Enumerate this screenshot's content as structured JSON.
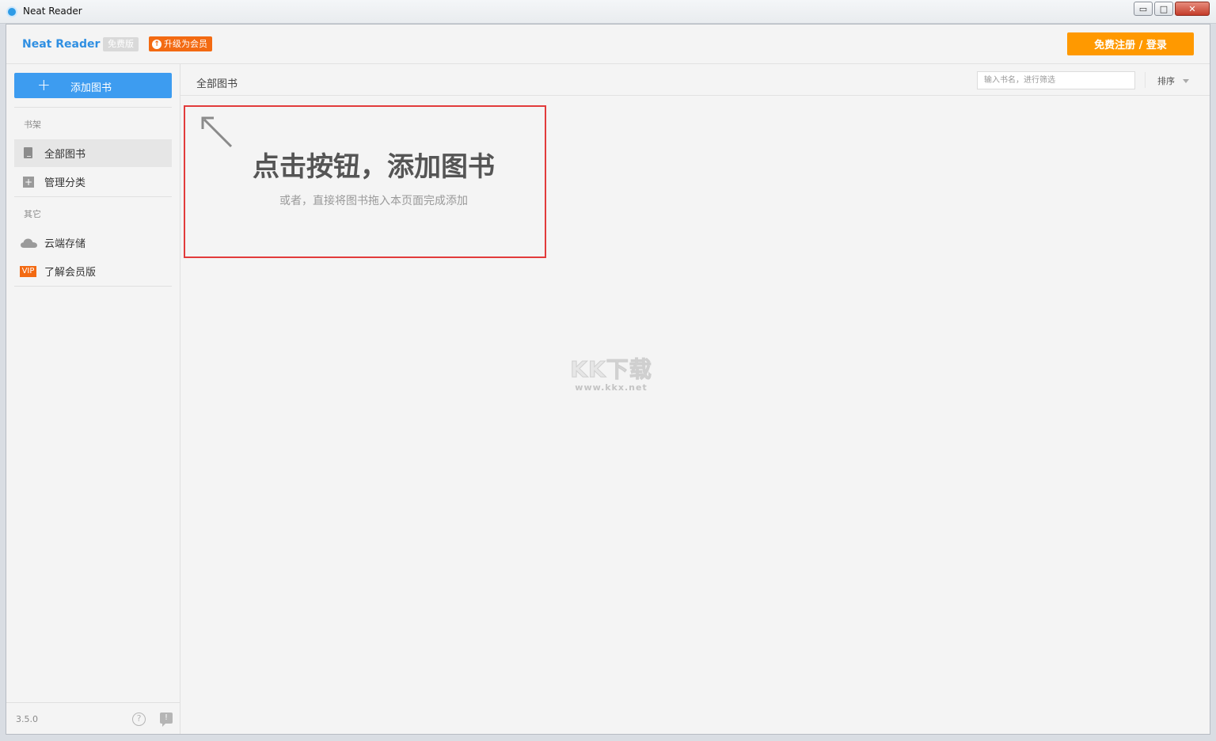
{
  "window": {
    "title": "Neat Reader",
    "controls": [
      "▭",
      "□",
      "✕"
    ]
  },
  "header": {
    "brand": "Neat Reader",
    "free_badge": "免费版",
    "upgrade_badge": "升级为会员",
    "login_button": "免费注册 / 登录"
  },
  "sidebar": {
    "add_book_label": "添加图书",
    "add_icon": "+",
    "section_bookshelf": "书架",
    "items_bookshelf": [
      {
        "label": "全部图书",
        "icon": "book-icon",
        "active": true
      },
      {
        "label": "管理分类",
        "icon": "plus-box-icon",
        "active": false
      }
    ],
    "section_other": "其它",
    "items_other": [
      {
        "label": "云端存储",
        "icon": "cloud-icon"
      },
      {
        "label": "了解会员版",
        "icon": "vip-icon",
        "badge": "VIP"
      }
    ],
    "version": "3.5.0",
    "help_glyph": "?",
    "feedback_glyph": "!"
  },
  "main": {
    "toolbar_title": "全部图书",
    "search_placeholder": "输入书名，进行筛选",
    "sort_label": "排序",
    "hint_title": "点击按钮，添加图书",
    "hint_subtitle": "或者，直接将图书拖入本页面完成添加"
  },
  "watermark": {
    "logo": "KK下载",
    "url": "www.kkx.net"
  },
  "colors": {
    "brand_blue": "#2f8fe2",
    "add_button_blue": "#3d9cf0",
    "login_orange": "#ff9900",
    "upgrade_orange": "#f36a12",
    "highlight_red": "#e23b3b"
  }
}
